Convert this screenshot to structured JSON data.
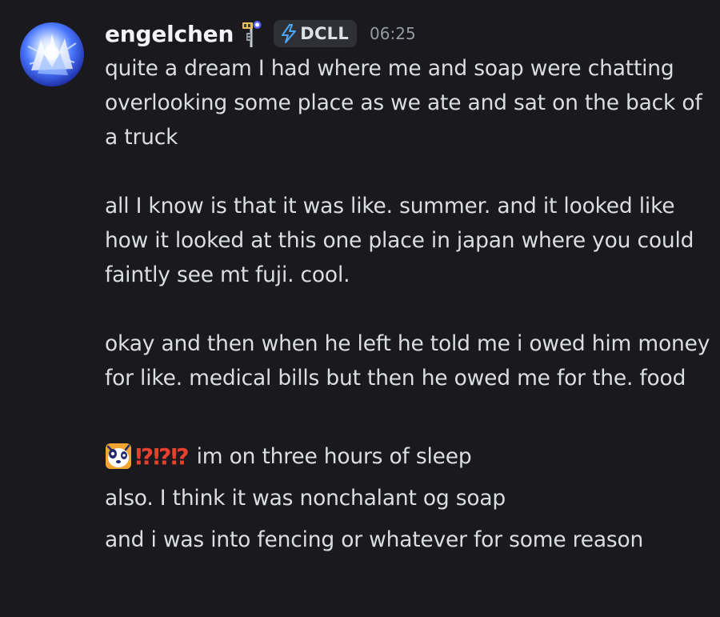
{
  "message": {
    "author": "engelchen",
    "role_icon": "signpost-badge-icon",
    "tag": {
      "icon": "lightning-bolt-icon",
      "label": "DCLL",
      "icon_color": "#4aa8ff"
    },
    "timestamp": "06:25",
    "paragraphs": [
      "quite a dream I had where me and soap were chatting overlooking some place as we ate and sat on the back of a truck",
      "all I know is that it was like. summer. and it looked like how it looked at this one place in japan where you could faintly see mt fuji. cool.",
      "okay and then when he left he told me i owed him money for like. medical bills but then he owed me for the. food"
    ],
    "followups": [
      {
        "emoji": "panda-face-emoji",
        "interrobangs": "⁉⁉⁉",
        "text": "im on three hours of sleep"
      },
      {
        "text": "also. I think it was nonchalant og soap"
      },
      {
        "text": "and i was into fencing or whatever for some reason"
      }
    ]
  },
  "colors": {
    "background": "#1a1a1e",
    "text": "#dbdee1",
    "username": "#f2f3f5",
    "timestamp": "#949ba4",
    "tag_background": "#2e3036",
    "interrobang": "#e8402c"
  }
}
